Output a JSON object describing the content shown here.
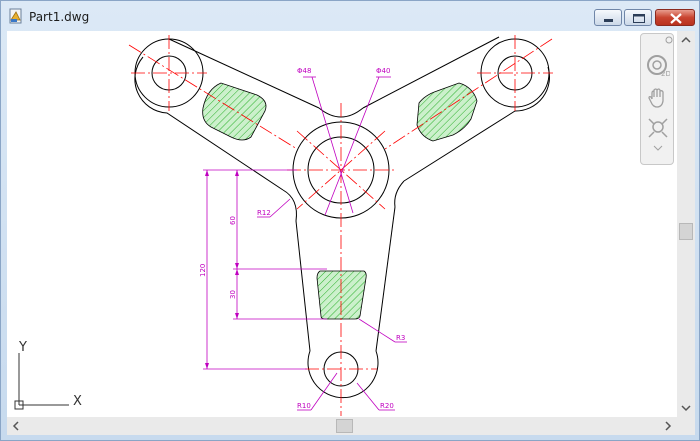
{
  "window": {
    "title": "Part1.dwg"
  },
  "controls": {
    "minimize": "minimize",
    "maximize": "maximize",
    "close": "close"
  },
  "drawing": {
    "dims": {
      "dia_small": "Φ48",
      "dia_large": "Φ40",
      "r12": "R12",
      "r3": "R3",
      "r10": "R10",
      "r20": "R20",
      "d60": "60",
      "d30": "30",
      "d120": "120"
    },
    "ucs": {
      "x": "X",
      "y": "Y"
    }
  },
  "colors": {
    "geometry": "#000000",
    "centerline": "#ff0000",
    "dimension": "#c000c0",
    "hatch": "#00a000",
    "hatch_fill": "#ccf0cc"
  }
}
